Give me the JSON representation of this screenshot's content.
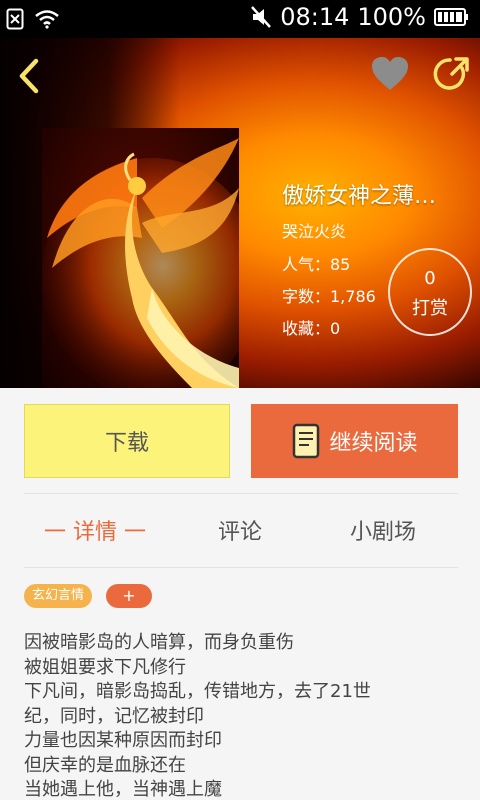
{
  "status_bar": {
    "time": "08:14",
    "battery_percent": "100%",
    "icons": [
      "sim-none-icon",
      "wifi-icon",
      "mute-icon",
      "battery-icon"
    ]
  },
  "header": {
    "icons": [
      "back-arrow-icon",
      "heart-icon",
      "share-icon"
    ],
    "colors": {
      "icon_yellow": "#f7e36a",
      "heart_gray": "#8c8c8c"
    }
  },
  "book": {
    "title": "傲娇女神之薄…",
    "author": "哭泣火炎",
    "popularity": "人气：85",
    "word_count": "字数：1,786",
    "favorites": "收藏：0",
    "tip_count": "0",
    "tip_label": "打赏"
  },
  "actions": {
    "download_label": "下载",
    "continue_label": "继续阅读",
    "colors": {
      "download_bg": "#fcf47a",
      "continue_bg": "#ea6a3d"
    }
  },
  "tabs": [
    {
      "label": "一 详情 一"
    },
    {
      "label": "评论"
    },
    {
      "label": "小剧场"
    }
  ],
  "tags": {
    "genre": "玄幻言情",
    "add": "+"
  },
  "synopsis": [
    "因被暗影岛的人暗算，而身负重伤",
    "被姐姐要求下凡修行",
    "下凡间，暗影岛捣乱，传错地方，去了21世",
    "纪，同时，记忆被封印",
    "力量也因某种原因而封印",
    "但庆幸的是血脉还在",
    "当她遇上他，当神遇上魔"
  ]
}
